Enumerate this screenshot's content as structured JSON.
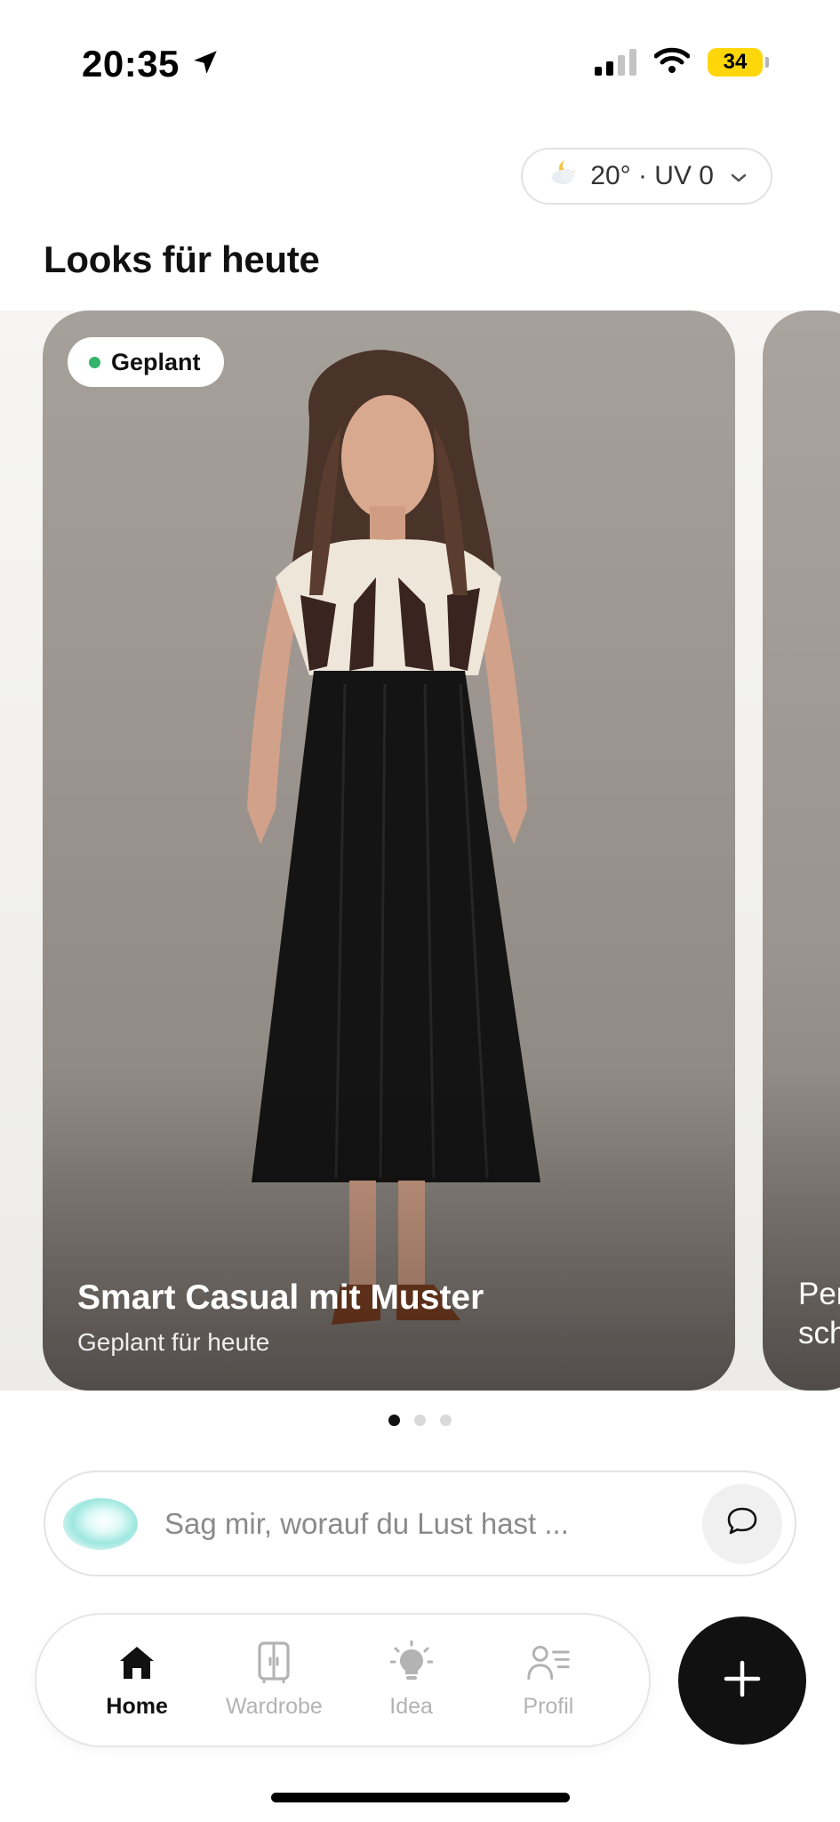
{
  "status_bar": {
    "time": "20:35",
    "battery": "34",
    "colors": {
      "battery": "#ffd60a"
    }
  },
  "weather": {
    "label": "20° · UV 0",
    "icon": "partly-cloudy-night-icon"
  },
  "section": {
    "title": "Looks für heute"
  },
  "looks": [
    {
      "badge": "Geplant",
      "badge_color": "#34b36b",
      "title": "Smart Casual mit Muster",
      "subtitle": "Geplant für heute"
    },
    {
      "title_line1": "Per",
      "title_line2": "sch"
    }
  ],
  "carousel": {
    "pages": 3,
    "active_page": 1
  },
  "chat": {
    "placeholder": "Sag mir, worauf du Lust hast ...",
    "send_icon": "chat-bubble-icon"
  },
  "tabs": [
    {
      "label": "Home",
      "icon": "home-icon",
      "active": true
    },
    {
      "label": "Wardrobe",
      "icon": "wardrobe-icon",
      "active": false
    },
    {
      "label": "Idea",
      "icon": "lightbulb-icon",
      "active": false
    },
    {
      "label": "Profil",
      "icon": "profile-icon",
      "active": false
    }
  ],
  "fab": {
    "icon": "plus-icon"
  }
}
